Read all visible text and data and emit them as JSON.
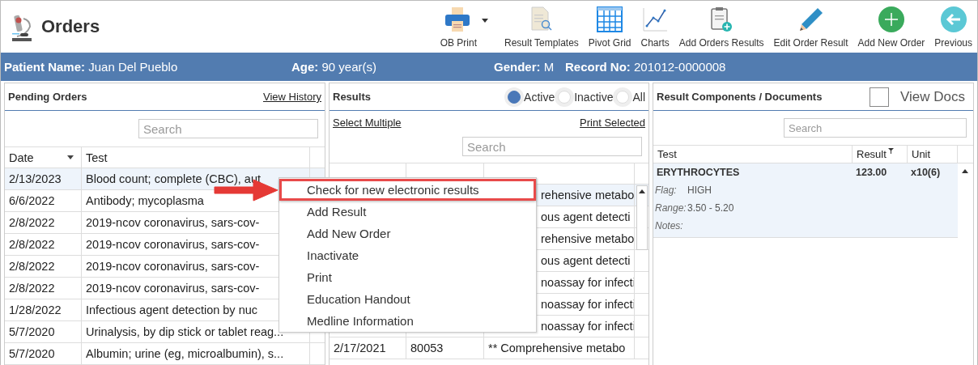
{
  "window": {
    "title": "Orders"
  },
  "toolbar": [
    {
      "label": "OB Print",
      "kind": "printer",
      "dropdown": true
    },
    {
      "label": "Result Templates",
      "kind": "document",
      "dropdown": false
    },
    {
      "label": "Pivot Grid",
      "kind": "grid",
      "dropdown": false
    },
    {
      "label": "Charts",
      "kind": "chart",
      "dropdown": false
    },
    {
      "label": "Add Orders Results",
      "kind": "clipboard",
      "dropdown": false
    },
    {
      "label": "Edit Order Result",
      "kind": "pencil",
      "dropdown": false
    },
    {
      "label": "Add New Order",
      "kind": "add",
      "dropdown": false
    },
    {
      "label": "Previous",
      "kind": "back",
      "dropdown": false
    }
  ],
  "patient": [
    {
      "label": "Patient Name:",
      "value": "Juan Del Pueblo"
    },
    {
      "label": "Age:",
      "value": "90 year(s)"
    },
    {
      "label": "Gender:",
      "value": "M"
    },
    {
      "label": "Record No:",
      "value": "201012-0000008"
    }
  ],
  "pending_orders": {
    "title": "Pending Orders",
    "link": "View History",
    "search": {
      "placeholder": "Search"
    },
    "columns": [
      "Date",
      "Test"
    ],
    "rows": [
      {
        "date": "2/13/2023",
        "test": "Blood count; complete (CBC), aut",
        "selected": true
      },
      {
        "date": "6/6/2022",
        "test": "Antibody; mycoplasma",
        "selected": false
      },
      {
        "date": "2/8/2022",
        "test": "2019-ncov coronavirus, sars-cov-",
        "selected": false
      },
      {
        "date": "2/8/2022",
        "test": "2019-ncov coronavirus, sars-cov-",
        "selected": false
      },
      {
        "date": "2/8/2022",
        "test": "2019-ncov coronavirus, sars-cov-",
        "selected": false
      },
      {
        "date": "2/8/2022",
        "test": "2019-ncov coronavirus, sars-cov-",
        "selected": false
      },
      {
        "date": "1/28/2022",
        "test": "Infectious agent detection by nuc",
        "selected": false
      },
      {
        "date": "5/7/2020",
        "test": "Urinalysis, by dip stick or tablet reag...",
        "selected": false
      },
      {
        "date": "5/7/2020",
        "test": "Albumin; urine (eg, microalbumin), s...",
        "selected": false
      }
    ]
  },
  "results": {
    "title": "Results",
    "filters": [
      {
        "label": "Active",
        "selected": true
      },
      {
        "label": "Inactive",
        "selected": false
      },
      {
        "label": "All",
        "selected": false
      }
    ],
    "select_multiple": "Select Multiple",
    "print_selected": "Print Selected",
    "search": {
      "placeholder": "Search"
    },
    "rows": [
      {
        "kind": "partial",
        "test": "rehensive metabo",
        "selected": true
      },
      {
        "kind": "partial",
        "test": "ous agent detecti",
        "selected": false
      },
      {
        "kind": "partial",
        "test": "rehensive metabo",
        "selected": false
      },
      {
        "kind": "partial",
        "test": "ous agent detecti",
        "selected": false
      },
      {
        "kind": "partial",
        "test": "noassay for infecti",
        "selected": false
      },
      {
        "kind": "partial",
        "test": "noassay for infecti",
        "selected": false
      },
      {
        "kind": "partial",
        "test": "noassay for infecti",
        "selected": false
      },
      {
        "kind": "full",
        "date": "2/17/2021",
        "code": "80053",
        "test": "** Comprehensive metabo",
        "selected": false
      }
    ]
  },
  "components": {
    "title": "Result Components / Documents",
    "view_docs": {
      "label": "View Docs",
      "checked": false
    },
    "search": {
      "placeholder": "Search"
    },
    "columns": [
      "Test",
      "Result",
      "Unit"
    ],
    "rows": [
      {
        "test": "ERYTHROCYTES",
        "result": "123.00",
        "unit": "x10(6)",
        "details": [
          {
            "label": "Flag:",
            "value": "HIGH"
          },
          {
            "label": "Range:",
            "value": "3.50 - 5.20"
          },
          {
            "label": "Notes:"
          }
        ]
      }
    ]
  },
  "context_menu": [
    {
      "label": "Check for new electronic results",
      "highlighted": true
    },
    {
      "label": "Add Result",
      "highlighted": false
    },
    {
      "label": "Add New Order",
      "highlighted": false
    },
    {
      "label": "Inactivate",
      "highlighted": false
    },
    {
      "label": "Print",
      "highlighted": false
    },
    {
      "label": "Education Handout",
      "highlighted": false
    },
    {
      "label": "Medline Information",
      "highlighted": false
    }
  ]
}
